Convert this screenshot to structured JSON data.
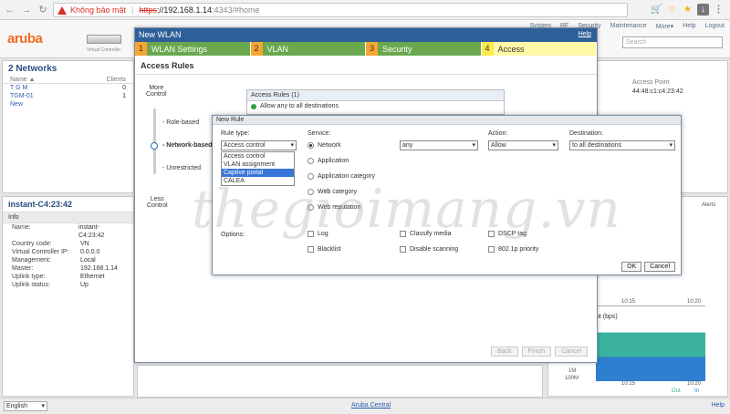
{
  "browser": {
    "security_label": "Không bảo mật",
    "url_https": "https",
    "url_host": "://192.168.1.14",
    "url_path": ":4343/#home"
  },
  "app": {
    "logo": "aruba",
    "controller_label": "Virtual Controller",
    "top_links": [
      "System",
      "RF",
      "Security",
      "Maintenance",
      "More▾",
      "Help",
      "Logout"
    ],
    "search_placeholder": "Search"
  },
  "networks_panel": {
    "title": "2 Networks",
    "col_name": "Name ▲",
    "col_clients": "Clients",
    "rows": [
      {
        "name": "T G M",
        "clients": "0"
      },
      {
        "name": "TGM-01",
        "clients": "1"
      },
      {
        "name": "New",
        "clients": ""
      }
    ]
  },
  "access_point_panel": {
    "label": "Access Point",
    "value": "44:48:c1:c4:23:42"
  },
  "instant_panel": {
    "title": "instant-C4:23:42",
    "info_head": "Info",
    "rows": [
      {
        "k": "Name:",
        "v": "instant-C4:23:42"
      },
      {
        "k": "Country code:",
        "v": "VN"
      },
      {
        "k": "Virtual Controller IP:",
        "v": "0.0.0.0"
      },
      {
        "k": "Management:",
        "v": "Local"
      },
      {
        "k": "Master:",
        "v": "192.168.1.14"
      },
      {
        "k": "Uplink type:",
        "v": "Ethernet"
      },
      {
        "k": "Uplink status:",
        "v": "Up"
      }
    ]
  },
  "right_charts": {
    "alerts": "Alerts",
    "t1": "10:15",
    "t2": "10:20",
    "throughput_label": "ut (bps)",
    "y1": "1M",
    "y2": "100M",
    "legend_out": "Out",
    "legend_in": "In"
  },
  "wlan": {
    "title": "New WLAN",
    "help": "Help",
    "steps": [
      {
        "num": "1",
        "label": "WLAN Settings"
      },
      {
        "num": "2",
        "label": "VLAN"
      },
      {
        "num": "3",
        "label": "Security"
      },
      {
        "num": "4",
        "label": "Access"
      }
    ],
    "section_title": "Access Rules",
    "more_control": "More\nControl",
    "less_control": "Less\nControl",
    "options": [
      "Role-based",
      "Network-based",
      "Unrestricted"
    ],
    "rules_header": "Access Rules (1)",
    "rules_item": "Allow any to all destinations",
    "footer": [
      "Back",
      "Finish",
      "Cancel"
    ]
  },
  "new_rule": {
    "title": "New Rule",
    "rule_type_label": "Rule type:",
    "rule_type_value": "Access control",
    "rule_type_options": [
      "Access control",
      "VLAN assignment",
      "Captive portal",
      "CALEA"
    ],
    "rule_type_highlight": "Captive portal",
    "service_label": "Service:",
    "services": [
      "Network",
      "Application",
      "Application category",
      "Web category",
      "Web reputation"
    ],
    "service_value": "any",
    "action_label": "Action:",
    "action_value": "Allow",
    "destination_label": "Destination:",
    "destination_value": "to all destinations",
    "options_label": "Options:",
    "checks": [
      "Log",
      "Blacklist",
      "Classify media",
      "Disable scanning",
      "DSCP tag",
      "802.1p priority"
    ],
    "ok": "OK",
    "cancel": "Cancel"
  },
  "bottom": {
    "language": "English",
    "aruba_central": "Aruba Central",
    "help": "Help"
  },
  "watermark": "thegioimang.vn",
  "colors": {
    "brand_orange": "#f26b21",
    "dialog_blue": "#2f5f98",
    "step_green": "#6aa84f",
    "step_num": "#f7a531",
    "highlight": "#3875d7"
  }
}
